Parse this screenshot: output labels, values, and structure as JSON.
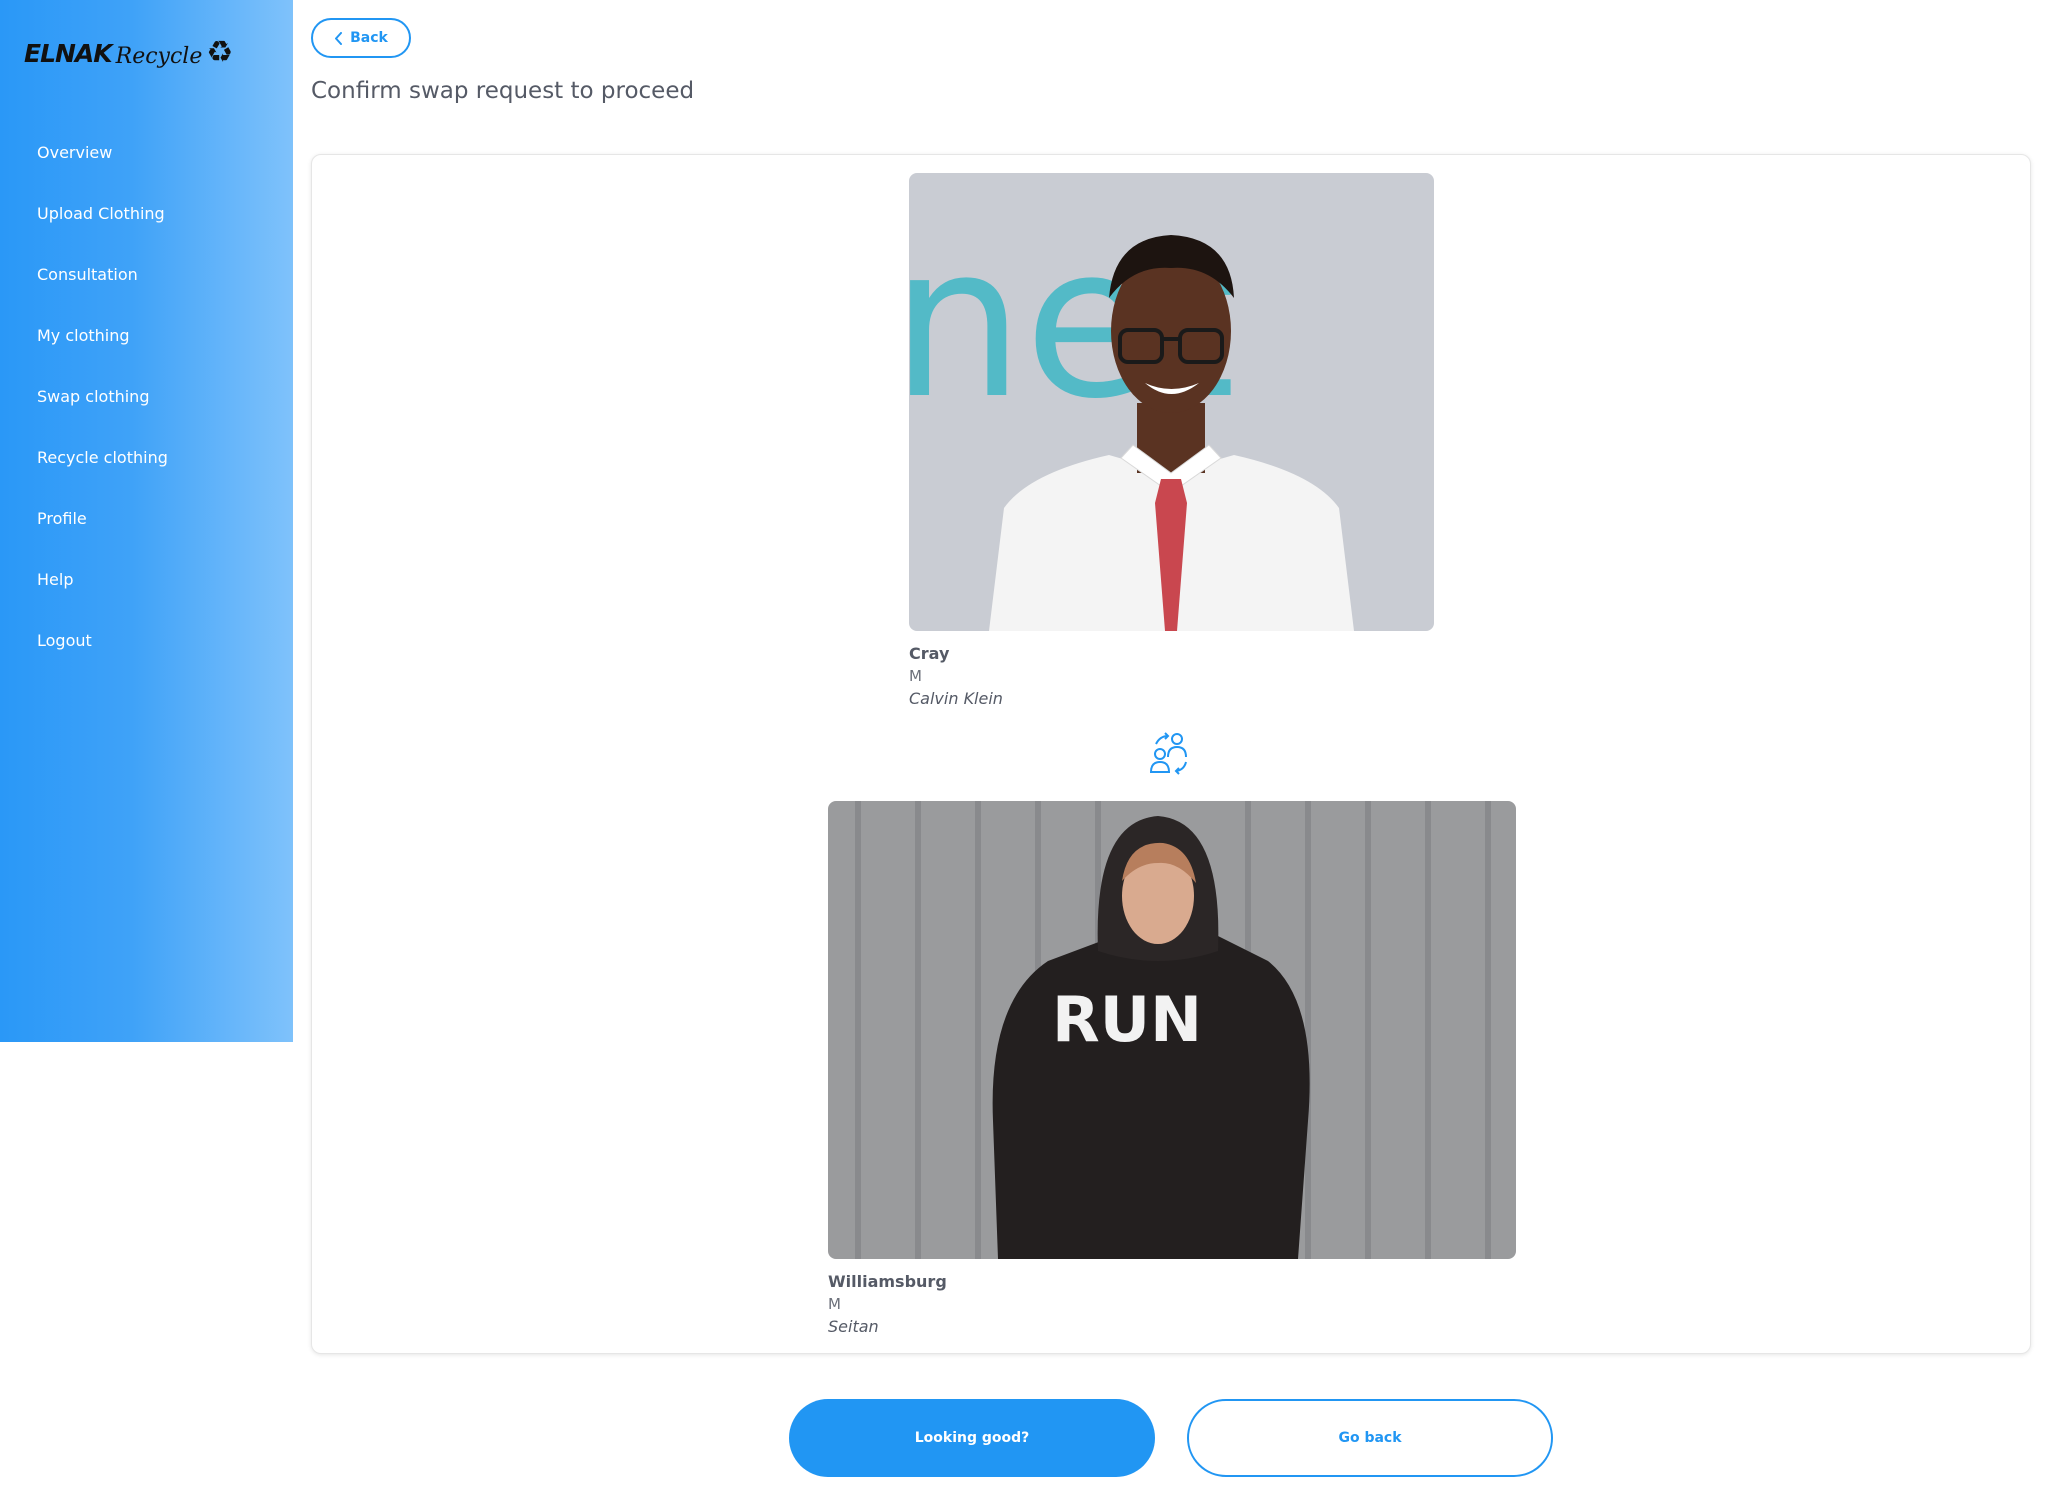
{
  "brand": {
    "wordmark": "ELNAK",
    "script": "Recycle",
    "logo_icon": "recycle-icon"
  },
  "sidebar": {
    "items": [
      {
        "label": "Overview"
      },
      {
        "label": "Upload Clothing"
      },
      {
        "label": "Consultation"
      },
      {
        "label": "My clothing"
      },
      {
        "label": "Swap clothing"
      },
      {
        "label": "Recycle clothing"
      },
      {
        "label": "Profile"
      },
      {
        "label": "Help"
      },
      {
        "label": "Logout"
      }
    ]
  },
  "header": {
    "back_label": "Back",
    "back_icon": "chevron-left-icon",
    "title": "Confirm swap request to proceed"
  },
  "swap": {
    "icon": "swap-people-icon",
    "items": [
      {
        "name": "Cray",
        "size": "M",
        "brand": "Calvin Klein"
      },
      {
        "name": "Williamsburg",
        "size": "M",
        "brand": "Seitan"
      }
    ]
  },
  "actions": {
    "confirm_label": "Looking good?",
    "cancel_label": "Go back"
  },
  "colors": {
    "accent": "#2196f3",
    "sidebar_gradient_start": "#2a98f7",
    "sidebar_gradient_end": "#7fc2fb"
  },
  "photo_overlay_text": {
    "top_sign": "net",
    "hoodie": "RUN"
  }
}
